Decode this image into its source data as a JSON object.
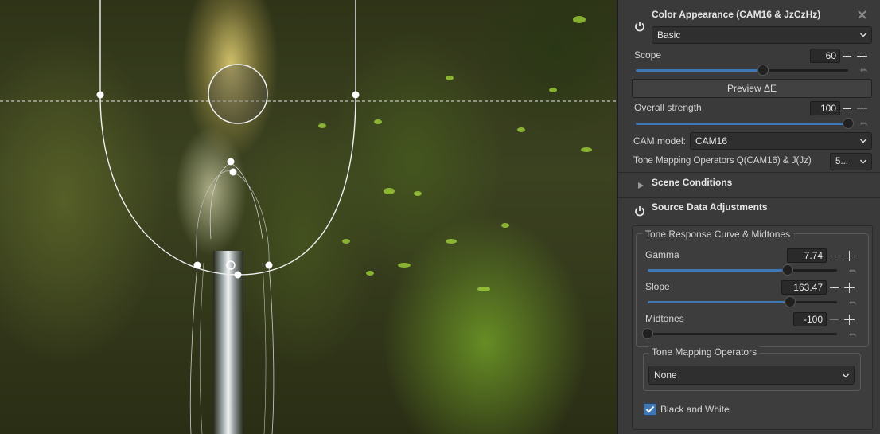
{
  "panel": {
    "title": "Color Appearance (CAM16 & JzCzHz)",
    "mode": "Basic",
    "scope": {
      "label": "Scope",
      "value": "60",
      "fraction": 0.6
    },
    "preview_label": "Preview ΔE",
    "overall_strength": {
      "label": "Overall strength",
      "value": "100",
      "fraction": 1.0
    },
    "cam_model": {
      "label": "CAM model:",
      "value": "CAM16"
    },
    "tone_mapping_ops": {
      "label": "Tone Mapping Operators Q(CAM16) & J(Jz)",
      "value": "5..."
    },
    "scene_conditions": "Scene Conditions",
    "source_data": "Source Data Adjustments",
    "trc_group": {
      "title": "Tone Response Curve & Midtones",
      "gamma": {
        "label": "Gamma",
        "value": "7.74",
        "fraction": 0.74
      },
      "slope": {
        "label": "Slope",
        "value": "163.47",
        "fraction": 0.75
      },
      "midtones": {
        "label": "Midtones",
        "value": "-100",
        "fraction": 0.0
      }
    },
    "tmo_group": {
      "title": "Tone Mapping Operators",
      "value": "None"
    },
    "black_white": {
      "label": "Black and White",
      "checked": true
    }
  },
  "colors": {
    "accent": "#3f77b5",
    "panel_bg": "#3a3a3a"
  }
}
